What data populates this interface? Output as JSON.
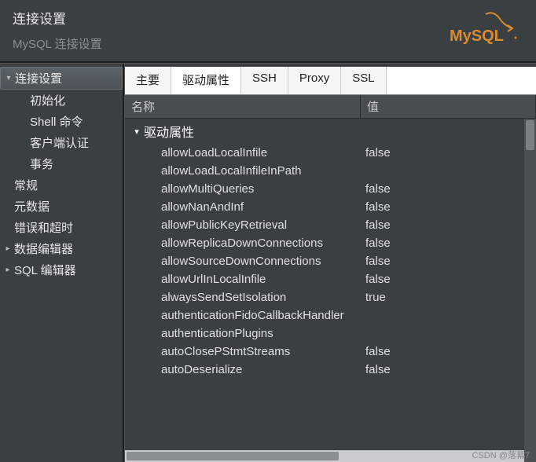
{
  "header": {
    "title": "连接设置",
    "subtitle": "MySQL 连接设置",
    "logo_text": "MySQL"
  },
  "sidebar": {
    "items": [
      {
        "label": "连接设置",
        "level": 0,
        "expanded": true,
        "selected": true,
        "arrow": true
      },
      {
        "label": "初始化",
        "level": 1
      },
      {
        "label": "Shell 命令",
        "level": 1
      },
      {
        "label": "客户端认证",
        "level": 1
      },
      {
        "label": "事务",
        "level": 1
      },
      {
        "label": "常规",
        "level": 0
      },
      {
        "label": "元数据",
        "level": 0
      },
      {
        "label": "错误和超时",
        "level": 0
      },
      {
        "label": "数据编辑器",
        "level": 0,
        "arrow": true,
        "collapsed": true
      },
      {
        "label": "SQL 编辑器",
        "level": 0,
        "arrow": true,
        "collapsed": true
      }
    ]
  },
  "tabs": {
    "items": [
      "主要",
      "驱动属性",
      "SSH",
      "Proxy",
      "SSL"
    ],
    "active": 1
  },
  "columns": {
    "name": "名称",
    "value": "值"
  },
  "properties": {
    "group_label": "驱动属性",
    "rows": [
      {
        "name": "allowLoadLocalInfile",
        "value": "false"
      },
      {
        "name": "allowLoadLocalInfileInPath",
        "value": ""
      },
      {
        "name": "allowMultiQueries",
        "value": "false"
      },
      {
        "name": "allowNanAndInf",
        "value": "false"
      },
      {
        "name": "allowPublicKeyRetrieval",
        "value": "false"
      },
      {
        "name": "allowReplicaDownConnections",
        "value": "false"
      },
      {
        "name": "allowSourceDownConnections",
        "value": "false"
      },
      {
        "name": "allowUrlInLocalInfile",
        "value": "false"
      },
      {
        "name": "alwaysSendSetIsolation",
        "value": "true"
      },
      {
        "name": "authenticationFidoCallbackHandler",
        "value": ""
      },
      {
        "name": "authenticationPlugins",
        "value": ""
      },
      {
        "name": "autoClosePStmtStreams",
        "value": "false"
      },
      {
        "name": "autoDeserialize",
        "value": "false"
      }
    ]
  },
  "watermark": "CSDN @落幕7"
}
